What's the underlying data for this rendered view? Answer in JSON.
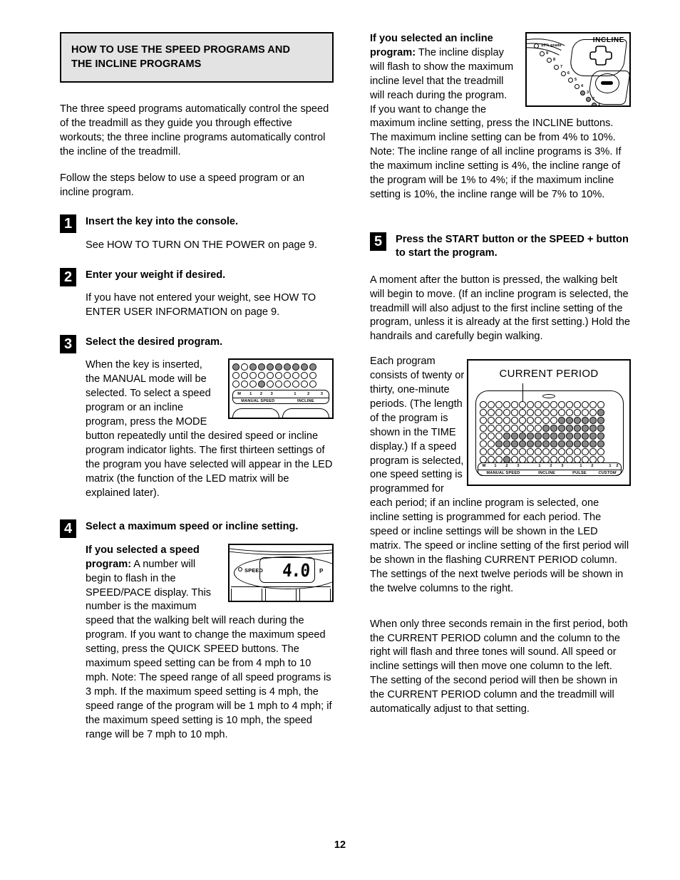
{
  "page_number": "12",
  "header": {
    "line1": "HOW TO USE THE SPEED PROGRAMS AND",
    "line2": "THE INCLINE PROGRAMS"
  },
  "left_column": {
    "intro1": "The three speed programs automatically control the speed of the treadmill as they guide you through effective workouts; the three incline programs automatically control the incline of the treadmill.",
    "intro2": "Follow the steps below to use a speed program or an incline program.",
    "steps": [
      {
        "number": "1",
        "title": "Insert the key into the console.",
        "body": [
          "See HOW TO TURN ON THE POWER on page 9."
        ]
      },
      {
        "number": "2",
        "title": "Enter your weight if desired.",
        "body": [
          "If you have not entered your weight, see HOW TO ENTER USER INFORMATION on page 9."
        ]
      },
      {
        "number": "3",
        "title": "Select the desired program.",
        "body": [
          "When the key is inserted, the MANUAL mode will be selected. To select a speed program or an incline program, press the MODE button repeatedly until the desired speed or incline program indicator lights. The first thirteen settings of the program you have selected will appear in the LED matrix (the function of the LED matrix will be explained later)."
        ]
      },
      {
        "number": "4",
        "title": "Select a maximum speed or incline setting.",
        "lead": "If you selected a speed program:",
        "body": [
          " A number will begin to flash in the SPEED/PACE display. This number is the maximum speed that the walking belt will reach during the program. If you want to change the maximum speed setting, press the QUICK SPEED buttons. The maximum speed setting can be from 4 mph to 10 mph. Note: The speed range of all speed programs is 3 mph. If the maximum speed setting is 4 mph, the speed range of the program will be 1 mph to 4 mph; if the maximum speed setting is 10 mph, the speed range will be 7 mph to 10 mph."
        ]
      }
    ]
  },
  "right_column": {
    "incline_lead": "If you selected an incline program:",
    "incline_text": " The incline display will flash to show the maximum incline level that the treadmill will reach during the program. If you want to change the maximum incline setting, press the INCLINE buttons. The maximum incline setting can be from 4% to 10%. Note: The incline range of all incline programs is 3%. If the maximum incline setting is 4%, the incline range of the program will be 1% to 4%; if the maximum incline setting is 10%, the incline range will be 7% to 10%.",
    "step5": {
      "number": "5",
      "title_line1": "Press the START button or the SPEED + button",
      "title_line2": "to start the program.",
      "para1": "A moment after the button is pressed, the walking belt will begin to move. (If an incline program is selected, the treadmill will also adjust to the first incline setting of the program, unless it is already at the first setting.) Hold the handrails and carefully begin walking.",
      "para2": "Each program consists of twenty or thirty, one-minute periods. (The length of the program is shown in the TIME display.) If a speed program is selected, one speed setting is programmed for each period; if an incline program is selected, one incline setting is programmed for each period. The speed or incline settings will be shown in the LED matrix. The speed or incline setting of the first period will be shown in the flashing CURRENT PERIOD column. The settings of the next twelve periods will be shown in the twelve columns to the right.",
      "para3": "When only three seconds remain in the first period, both the CURRENT PERIOD column and the column to the right will flash and three tones will sound. All speed or incline settings will then move one column to the left. The setting of the second period will then be shown in the CURRENT PERIOD column and the treadmill will automatically adjust to that setting."
    }
  },
  "figures": {
    "led_small": {
      "name": "led-matrix-small",
      "rows": [
        [
          0,
          0,
          1,
          1,
          1,
          1,
          1,
          1,
          1,
          1
        ],
        [
          0,
          0,
          0,
          0,
          0,
          0,
          0,
          0,
          0,
          0
        ],
        [
          0,
          0,
          0,
          1,
          0,
          0,
          0,
          0,
          0,
          0
        ]
      ],
      "legend_nums": [
        "M",
        "1",
        "2",
        "3",
        "",
        "1",
        "2",
        "3"
      ],
      "legend_names": [
        "MANUAL SPEED",
        "INCLINE"
      ]
    },
    "speed_display": {
      "name": "speed-pace-display",
      "indicator_label": "SPEED",
      "value": "4.0",
      "unit_hint": "P"
    },
    "incline_display": {
      "name": "incline-display",
      "title": "INCLINE",
      "top_label": "10% grade",
      "levels": [
        {
          "label": "9",
          "lit": false
        },
        {
          "label": "8",
          "lit": false
        },
        {
          "label": "7",
          "lit": false
        },
        {
          "label": "6",
          "lit": false
        },
        {
          "label": "5",
          "lit": false
        },
        {
          "label": "4",
          "lit": false
        },
        {
          "label": "3",
          "lit": true
        },
        {
          "label": "2",
          "lit": true
        },
        {
          "label": "1",
          "lit": true
        }
      ]
    },
    "current_period": {
      "name": "current-period-led-matrix",
      "title": "CURRENT PERIOD",
      "rows": [
        [
          0,
          0,
          0,
          0,
          0,
          0,
          0,
          0,
          0,
          0,
          0,
          0,
          0,
          0,
          0,
          0
        ],
        [
          0,
          0,
          0,
          0,
          0,
          0,
          0,
          0,
          0,
          0,
          0,
          0,
          0,
          0,
          0,
          1
        ],
        [
          0,
          0,
          0,
          0,
          0,
          0,
          0,
          0,
          0,
          0,
          1,
          1,
          1,
          1,
          1,
          1
        ],
        [
          0,
          0,
          0,
          0,
          0,
          0,
          0,
          0,
          1,
          1,
          1,
          1,
          1,
          1,
          1,
          1
        ],
        [
          0,
          0,
          0,
          1,
          1,
          1,
          1,
          1,
          1,
          1,
          1,
          1,
          1,
          1,
          1,
          1
        ],
        [
          0,
          0,
          1,
          1,
          1,
          1,
          1,
          1,
          1,
          1,
          1,
          1,
          1,
          1,
          1,
          1
        ],
        [
          0,
          0,
          0,
          0,
          0,
          0,
          0,
          0,
          0,
          0,
          0,
          0,
          0,
          0,
          0,
          0
        ],
        [
          0,
          0,
          0,
          1,
          0,
          0,
          0,
          0,
          0,
          0,
          0,
          0,
          0,
          0,
          0,
          0
        ]
      ],
      "legend_nums": [
        "M",
        "1",
        "2",
        "3",
        "",
        "1",
        "2",
        "3",
        "",
        "1",
        "2",
        "",
        "1",
        "2"
      ],
      "legend_names": [
        "MANUAL SPEED",
        "INCLINE",
        "PULSE",
        "CUSTOM"
      ]
    }
  }
}
